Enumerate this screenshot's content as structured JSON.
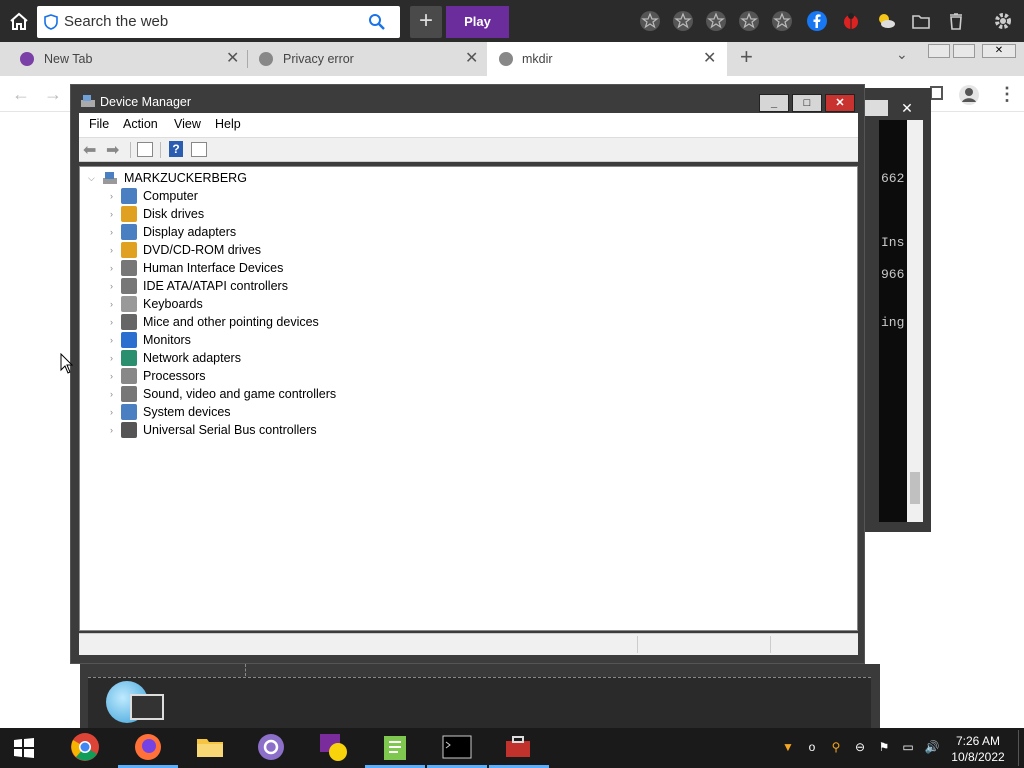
{
  "browser": {
    "search_placeholder": "Search the web",
    "play_label": "Play",
    "plus_label": "+",
    "tabs": [
      {
        "label": "New Tab"
      },
      {
        "label": "Privacy error"
      },
      {
        "label": "mkdir"
      }
    ],
    "new_tab_label": "+"
  },
  "console": {
    "lines": [
      "662",
      "Ins",
      "966",
      "ing"
    ]
  },
  "device_manager": {
    "title": "Device Manager",
    "menu": [
      "File",
      "Action",
      "View",
      "Help"
    ],
    "root": "MARKZUCKERBERG",
    "items": [
      "Computer",
      "Disk drives",
      "Display adapters",
      "DVD/CD-ROM drives",
      "Human Interface Devices",
      "IDE ATA/ATAPI controllers",
      "Keyboards",
      "Mice and other pointing devices",
      "Monitors",
      "Network adapters",
      "Processors",
      "Sound, video and game controllers",
      "System devices",
      "Universal Serial Bus controllers"
    ],
    "buttons": {
      "minimize": "_",
      "maximize": "□",
      "close": "✕"
    }
  },
  "taskbar": {
    "time": "7:26 AM",
    "date": "10/8/2022",
    "apps": [
      "windows-start",
      "chrome",
      "firefox",
      "file-explorer",
      "proton-mail",
      "yahoo-messenger",
      "notepad-plus-plus",
      "command-prompt",
      "toolbox"
    ]
  },
  "colors": {
    "titlebar": "#3c3c3c",
    "close_red": "#c9332f",
    "play_purple": "#6b2c9c",
    "taskbar": "#1a1a1a"
  }
}
